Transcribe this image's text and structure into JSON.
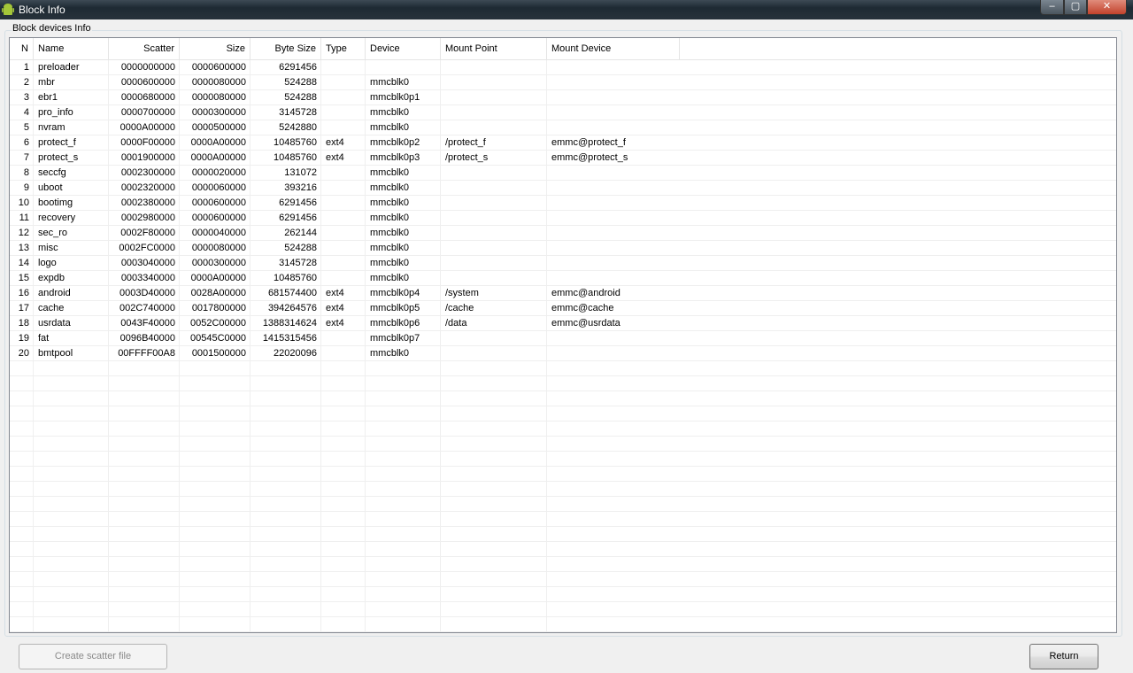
{
  "window": {
    "title": "Block Info",
    "controls": {
      "minimize": "–",
      "maximize": "▢",
      "close": "✕"
    }
  },
  "group": {
    "label": "Block devices Info"
  },
  "table": {
    "columns": [
      "N",
      "Name",
      "Scatter",
      "Size",
      "Byte Size",
      "Type",
      "Device",
      "Mount Point",
      "Mount Device"
    ],
    "rows": [
      [
        "1",
        "preloader",
        "0000000000",
        "0000600000",
        "6291456",
        "",
        "",
        "",
        ""
      ],
      [
        "2",
        "mbr",
        "0000600000",
        "0000080000",
        "524288",
        "",
        "mmcblk0",
        "",
        ""
      ],
      [
        "3",
        "ebr1",
        "0000680000",
        "0000080000",
        "524288",
        "",
        "mmcblk0p1",
        "",
        ""
      ],
      [
        "4",
        "pro_info",
        "0000700000",
        "0000300000",
        "3145728",
        "",
        "mmcblk0",
        "",
        ""
      ],
      [
        "5",
        "nvram",
        "0000A00000",
        "0000500000",
        "5242880",
        "",
        "mmcblk0",
        "",
        ""
      ],
      [
        "6",
        "protect_f",
        "0000F00000",
        "0000A00000",
        "10485760",
        "ext4",
        "mmcblk0p2",
        "/protect_f",
        "emmc@protect_f"
      ],
      [
        "7",
        "protect_s",
        "0001900000",
        "0000A00000",
        "10485760",
        "ext4",
        "mmcblk0p3",
        "/protect_s",
        "emmc@protect_s"
      ],
      [
        "8",
        "seccfg",
        "0002300000",
        "0000020000",
        "131072",
        "",
        "mmcblk0",
        "",
        ""
      ],
      [
        "9",
        "uboot",
        "0002320000",
        "0000060000",
        "393216",
        "",
        "mmcblk0",
        "",
        ""
      ],
      [
        "10",
        "bootimg",
        "0002380000",
        "0000600000",
        "6291456",
        "",
        "mmcblk0",
        "",
        ""
      ],
      [
        "11",
        "recovery",
        "0002980000",
        "0000600000",
        "6291456",
        "",
        "mmcblk0",
        "",
        ""
      ],
      [
        "12",
        "sec_ro",
        "0002F80000",
        "0000040000",
        "262144",
        "",
        "mmcblk0",
        "",
        ""
      ],
      [
        "13",
        "misc",
        "0002FC0000",
        "0000080000",
        "524288",
        "",
        "mmcblk0",
        "",
        ""
      ],
      [
        "14",
        "logo",
        "0003040000",
        "0000300000",
        "3145728",
        "",
        "mmcblk0",
        "",
        ""
      ],
      [
        "15",
        "expdb",
        "0003340000",
        "0000A00000",
        "10485760",
        "",
        "mmcblk0",
        "",
        ""
      ],
      [
        "16",
        "android",
        "0003D40000",
        "0028A00000",
        "681574400",
        "ext4",
        "mmcblk0p4",
        "/system",
        "emmc@android"
      ],
      [
        "17",
        "cache",
        "002C740000",
        "0017800000",
        "394264576",
        "ext4",
        "mmcblk0p5",
        "/cache",
        "emmc@cache"
      ],
      [
        "18",
        "usrdata",
        "0043F40000",
        "0052C00000",
        "1388314624",
        "ext4",
        "mmcblk0p6",
        "/data",
        "emmc@usrdata"
      ],
      [
        "19",
        "fat",
        "0096B40000",
        "00545C0000",
        "1415315456",
        "",
        "mmcblk0p7",
        "",
        ""
      ],
      [
        "20",
        "bmtpool",
        "00FFFF00A8",
        "0001500000",
        "22020096",
        "",
        "mmcblk0",
        "",
        ""
      ]
    ]
  },
  "buttons": {
    "create_scatter": "Create scatter file",
    "return": "Return"
  }
}
